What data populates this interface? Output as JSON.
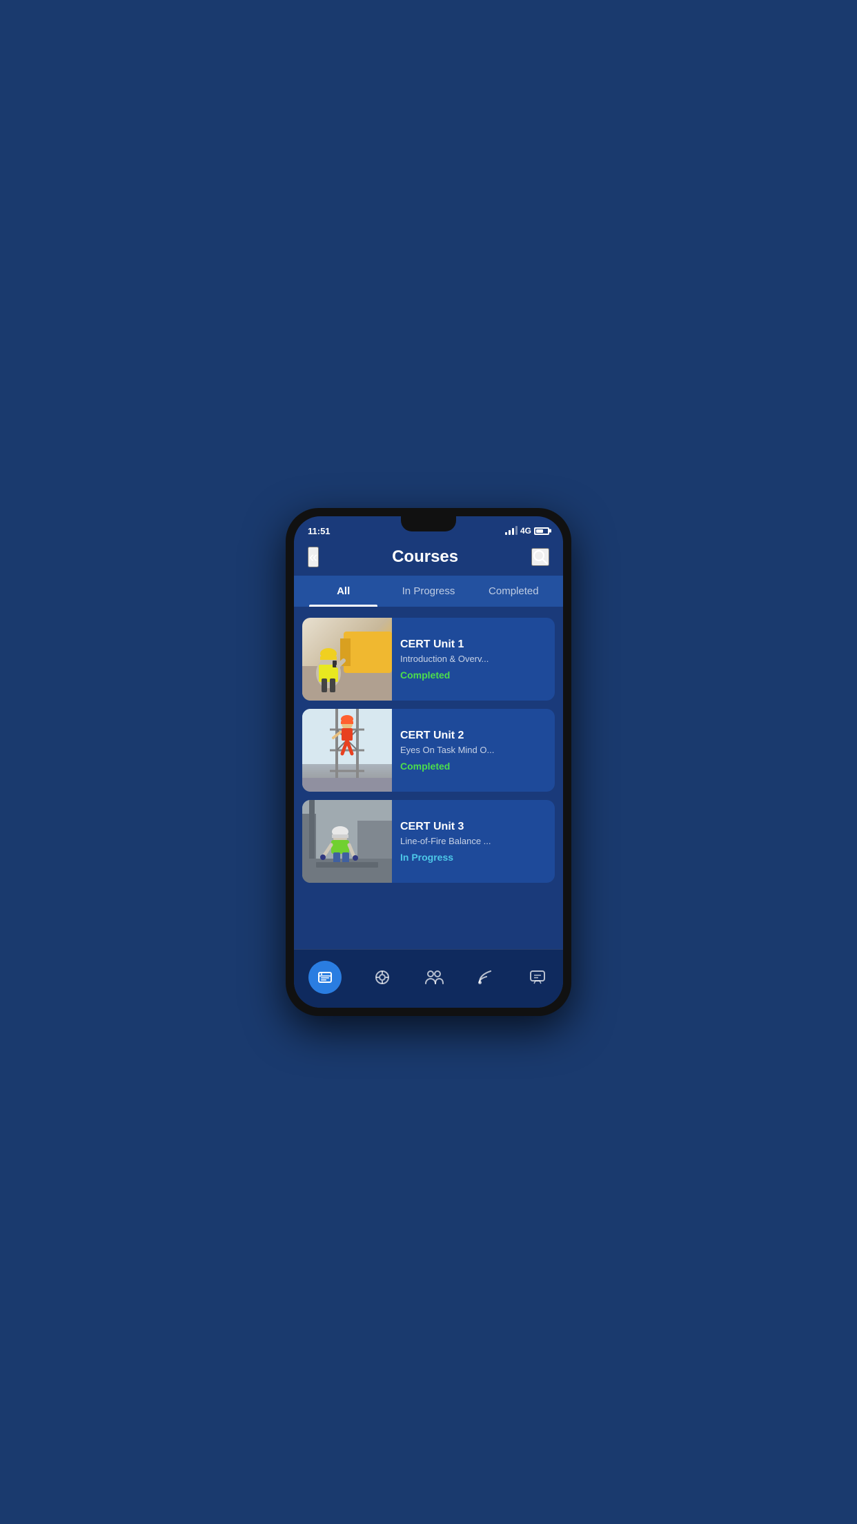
{
  "status_bar": {
    "time": "11:51",
    "network": "4G"
  },
  "header": {
    "back_icon": "«",
    "title": "Courses",
    "search_icon": "🔍"
  },
  "tabs": [
    {
      "id": "all",
      "label": "All",
      "active": true
    },
    {
      "id": "in_progress",
      "label": "In Progress",
      "active": false
    },
    {
      "id": "completed",
      "label": "Completed",
      "active": false
    }
  ],
  "courses": [
    {
      "id": "cert1",
      "title": "CERT Unit 1",
      "subtitle": "Introduction & Overv...",
      "status": "Completed",
      "status_type": "completed"
    },
    {
      "id": "cert2",
      "title": "CERT Unit 2",
      "subtitle": "Eyes On Task Mind O...",
      "status": "Completed",
      "status_type": "completed"
    },
    {
      "id": "cert3",
      "title": "CERT Unit 3",
      "subtitle": "Line-of-Fire Balance ...",
      "status": "In Progress",
      "status_type": "inprogress"
    }
  ],
  "bottom_nav": [
    {
      "id": "courses",
      "icon": "courses-icon",
      "active": true
    },
    {
      "id": "learn",
      "icon": "learn-icon",
      "active": false
    },
    {
      "id": "team",
      "icon": "team-icon",
      "active": false
    },
    {
      "id": "feed",
      "icon": "feed-icon",
      "active": false
    },
    {
      "id": "chat",
      "icon": "chat-icon",
      "active": false
    }
  ]
}
